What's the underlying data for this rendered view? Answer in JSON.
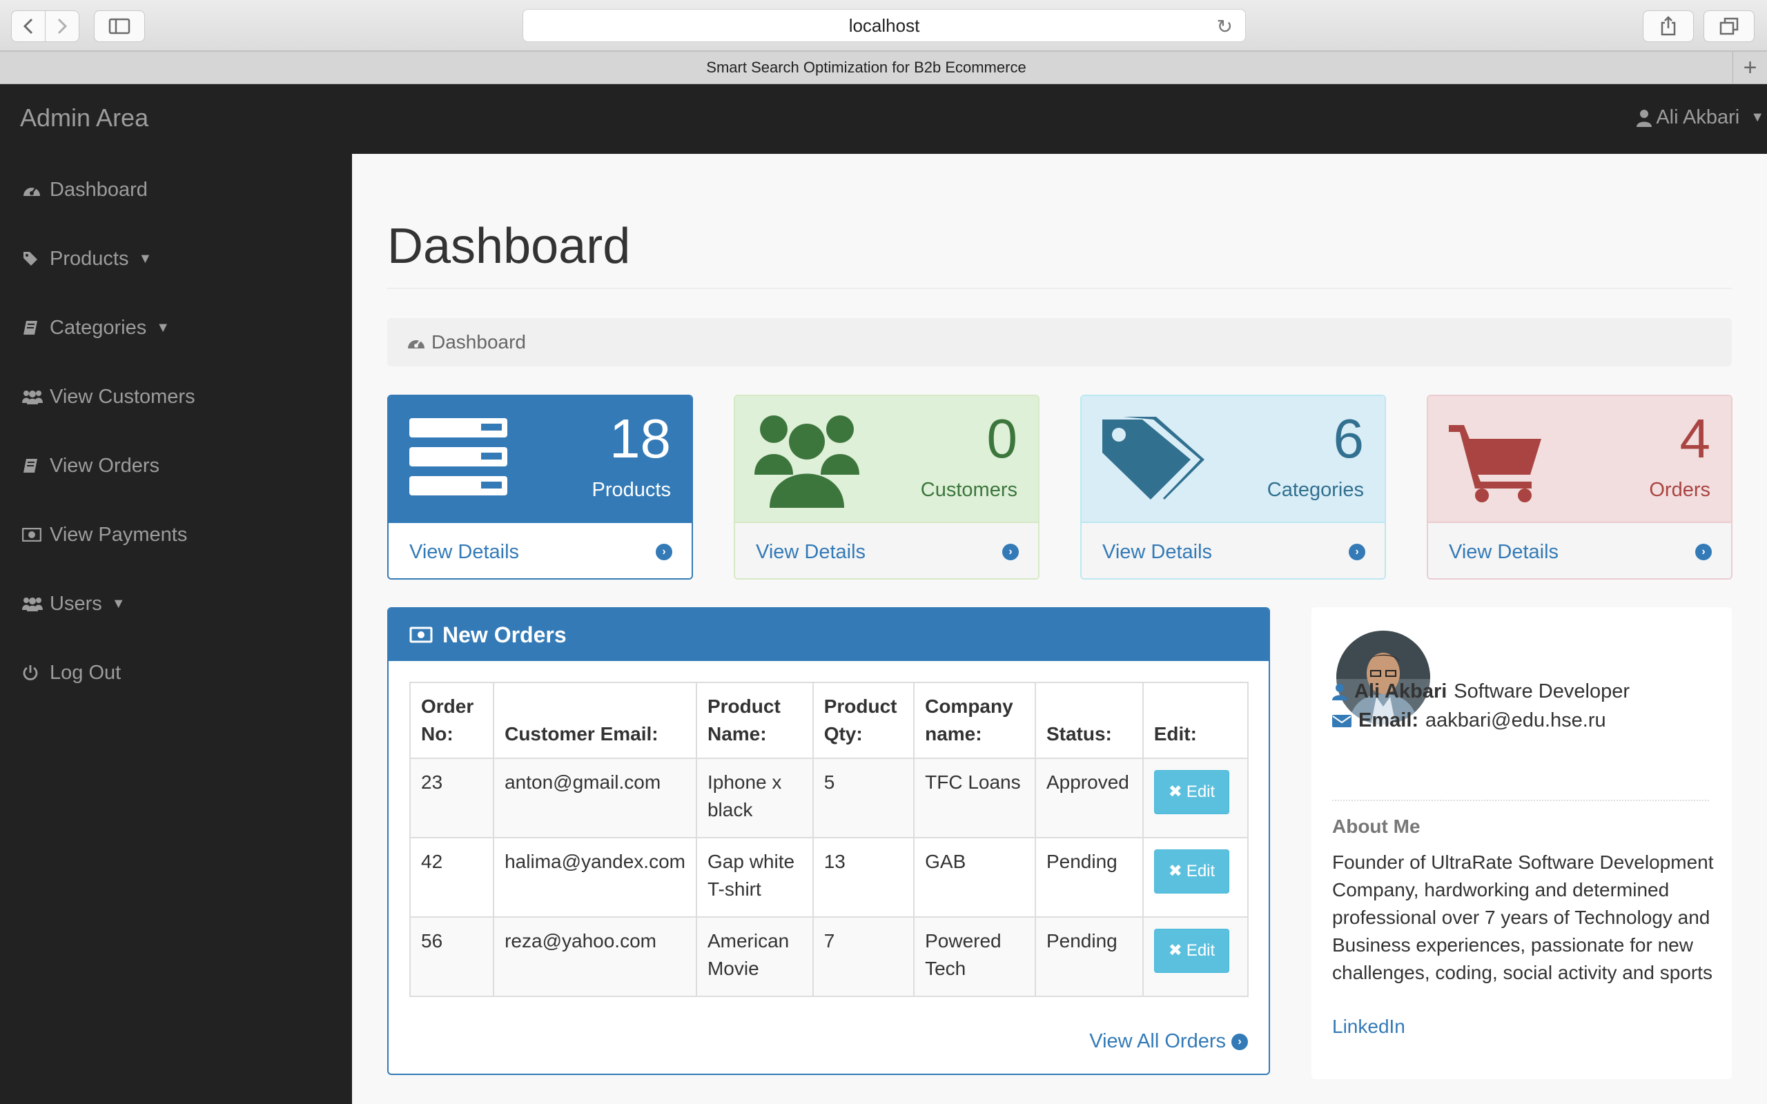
{
  "browser": {
    "url": "localhost",
    "tab_title": "Smart Search Optimization for B2b Ecommerce"
  },
  "navbar": {
    "brand": "Admin Area",
    "user_name": "Ali Akbari"
  },
  "sidebar": {
    "items": [
      {
        "label": "Dashboard",
        "icon": "dashboard-icon"
      },
      {
        "label": "Products",
        "icon": "tag-icon",
        "has_caret": true
      },
      {
        "label": "Categories",
        "icon": "book-icon",
        "has_caret": true
      },
      {
        "label": "View Customers",
        "icon": "users-icon"
      },
      {
        "label": "View Orders",
        "icon": "book-icon"
      },
      {
        "label": "View Payments",
        "icon": "money-icon"
      },
      {
        "label": "Users",
        "icon": "users-icon",
        "has_caret": true
      },
      {
        "label": "Log Out",
        "icon": "power-icon"
      }
    ]
  },
  "main": {
    "title": "Dashboard",
    "breadcrumb": "Dashboard",
    "stats": [
      {
        "value": "18",
        "label": "Products",
        "link": "View Details",
        "icon": "list-icon",
        "color": "#337ab7"
      },
      {
        "value": "0",
        "label": "Customers",
        "link": "View Details",
        "icon": "users-icon",
        "color": "#3c763d"
      },
      {
        "value": "6",
        "label": "Categories",
        "link": "View Details",
        "icon": "tags-icon",
        "color": "#31708f"
      },
      {
        "value": "4",
        "label": "Orders",
        "link": "View Details",
        "icon": "cart-icon",
        "color": "#a94442"
      }
    ]
  },
  "orders": {
    "title": "New Orders",
    "headers": [
      "Order No:",
      "Customer Email:",
      "Product Name:",
      "Product Qty:",
      "Company name:",
      "Status:",
      "Edit:"
    ],
    "rows": [
      {
        "order_no": "23",
        "email": "anton@gmail.com",
        "product": "Iphone x black",
        "qty": "5",
        "company": "TFC Loans",
        "status": "Approved",
        "edit": "Edit"
      },
      {
        "order_no": "42",
        "email": "halima@yandex.com",
        "product": "Gap white T-shirt",
        "qty": "13",
        "company": "GAB",
        "status": "Pending",
        "edit": "Edit"
      },
      {
        "order_no": "56",
        "email": "reza@yahoo.com",
        "product": "American Movie",
        "qty": "7",
        "company": "Powered Tech",
        "status": "Pending",
        "edit": "Edit"
      }
    ],
    "view_all": "View All Orders"
  },
  "profile": {
    "name": "Ali Akbari",
    "role": "Software Developer",
    "email_label": "Email:",
    "email": "aakbari@edu.hse.ru",
    "about_heading": "About Me",
    "about_text": "Founder of UltraRate Software Development Company, hardworking and determined professional over 7 years of Technology and Business experiences, passionate for new challenges, coding, social activity and sports",
    "link": "LinkedIn"
  }
}
